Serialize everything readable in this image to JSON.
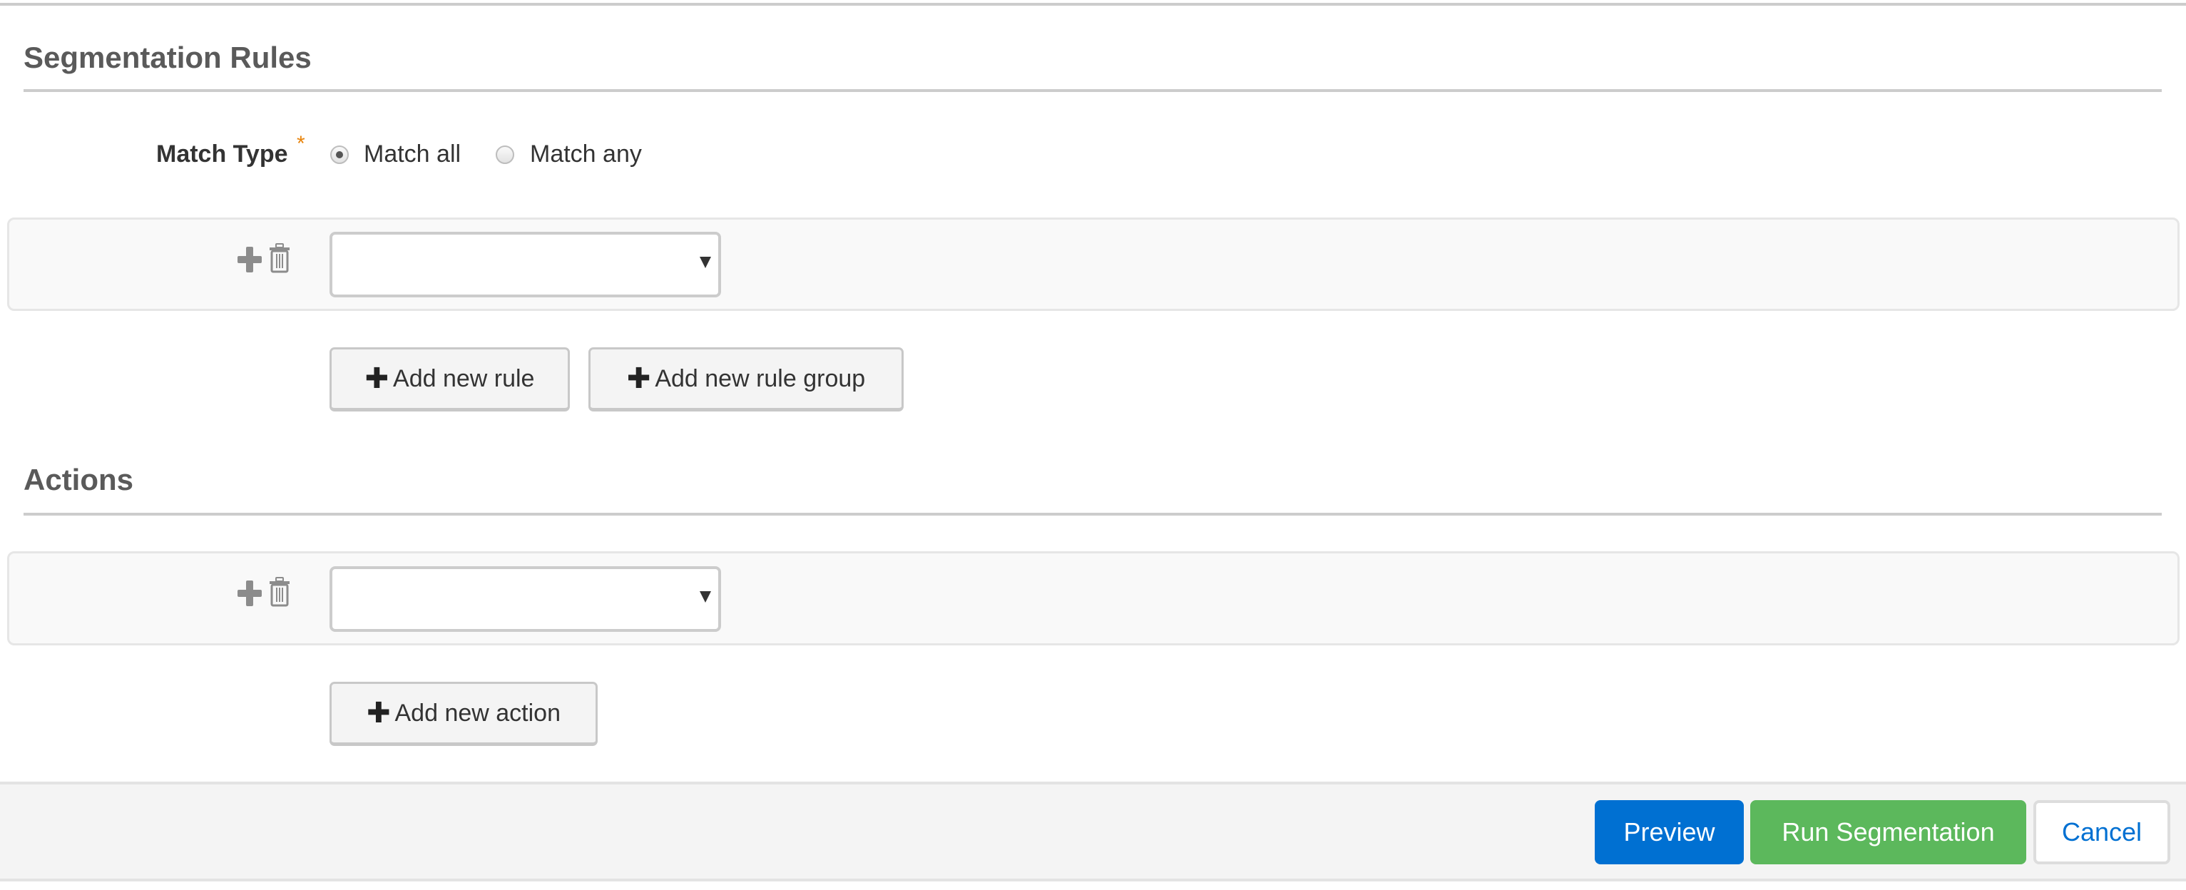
{
  "segmentation_rules": {
    "title": "Segmentation Rules",
    "match_type": {
      "label": "Match Type",
      "required_marker": "*",
      "options": [
        {
          "label": "Match all",
          "checked": true
        },
        {
          "label": "Match any",
          "checked": false
        }
      ]
    },
    "rule_row": {
      "add_icon": "plus-icon",
      "delete_icon": "trash-icon",
      "select_value": ""
    },
    "add_rule_label": "Add new rule",
    "add_rule_group_label": "Add new rule group"
  },
  "actions": {
    "title": "Actions",
    "action_row": {
      "add_icon": "plus-icon",
      "delete_icon": "trash-icon",
      "select_value": ""
    },
    "add_action_label": "Add new action"
  },
  "footer": {
    "preview_label": "Preview",
    "run_label": "Run Segmentation",
    "cancel_label": "Cancel"
  },
  "colors": {
    "primary": "#0070d2",
    "success": "#5cb85c",
    "required": "#e8840c"
  }
}
